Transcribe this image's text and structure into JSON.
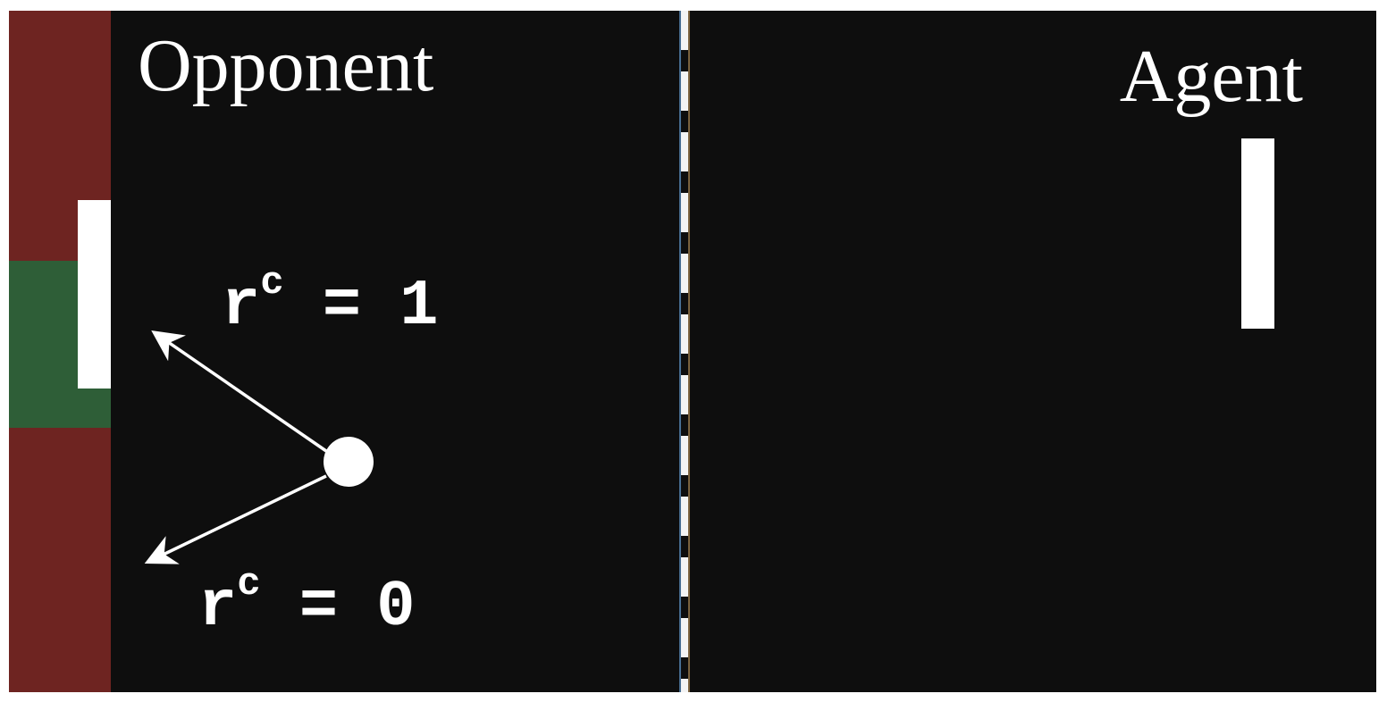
{
  "labels": {
    "opponent": "Opponent",
    "agent": "Agent"
  },
  "rewards": {
    "up": {
      "base": "r",
      "sup": "c",
      "rest": " = 1"
    },
    "down": {
      "base": "r",
      "sup": "c",
      "rest": " = 0"
    }
  },
  "colors": {
    "court": "#0e0e0e",
    "goal_zone_miss": "#6e2421",
    "goal_zone_hit": "#2e5e37",
    "paddle": "#ffffff",
    "ball": "#ffffff",
    "center_line": "#f4f4f4"
  },
  "icons": {
    "up_arrow": "arrow-up-left-icon",
    "down_arrow": "arrow-down-left-icon"
  }
}
